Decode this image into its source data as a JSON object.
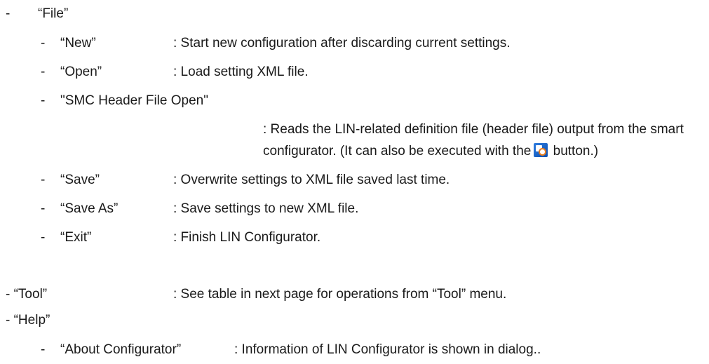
{
  "file": {
    "dash": "-",
    "label": "“File”",
    "items": [
      {
        "dash": "-",
        "label": "“New”",
        "desc": ": Start new configuration after discarding current settings."
      },
      {
        "dash": "-",
        "label": "“Open”",
        "desc": ": Load setting XML file."
      },
      {
        "dash": "-",
        "label": "\"SMC Header File Open\""
      },
      {
        "dash": "-",
        "label": "“Save”",
        "desc": ": Overwrite settings to XML file saved last time."
      },
      {
        "dash": "-",
        "label": "“Save As”",
        "desc": ": Save settings to new XML file."
      },
      {
        "dash": "-",
        "label": "“Exit”",
        "desc": ": Finish LIN Configurator."
      }
    ],
    "smc_desc_line1": ": Reads the LIN-related definition file (header file) output from the smart",
    "smc_desc_line2_before": "configurator. (It can also be executed with the",
    "smc_desc_line2_after": " button.)",
    "smc_icon": "smart-configurator-icon"
  },
  "tool": {
    "label": "- “Tool”",
    "desc": ": See table in next page for operations from “Tool” menu."
  },
  "help": {
    "label": "- “Help”",
    "items": [
      {
        "dash": "-",
        "label": "“About Configurator”",
        "desc": ": Information of LIN Configurator is shown in dialog.."
      }
    ]
  }
}
